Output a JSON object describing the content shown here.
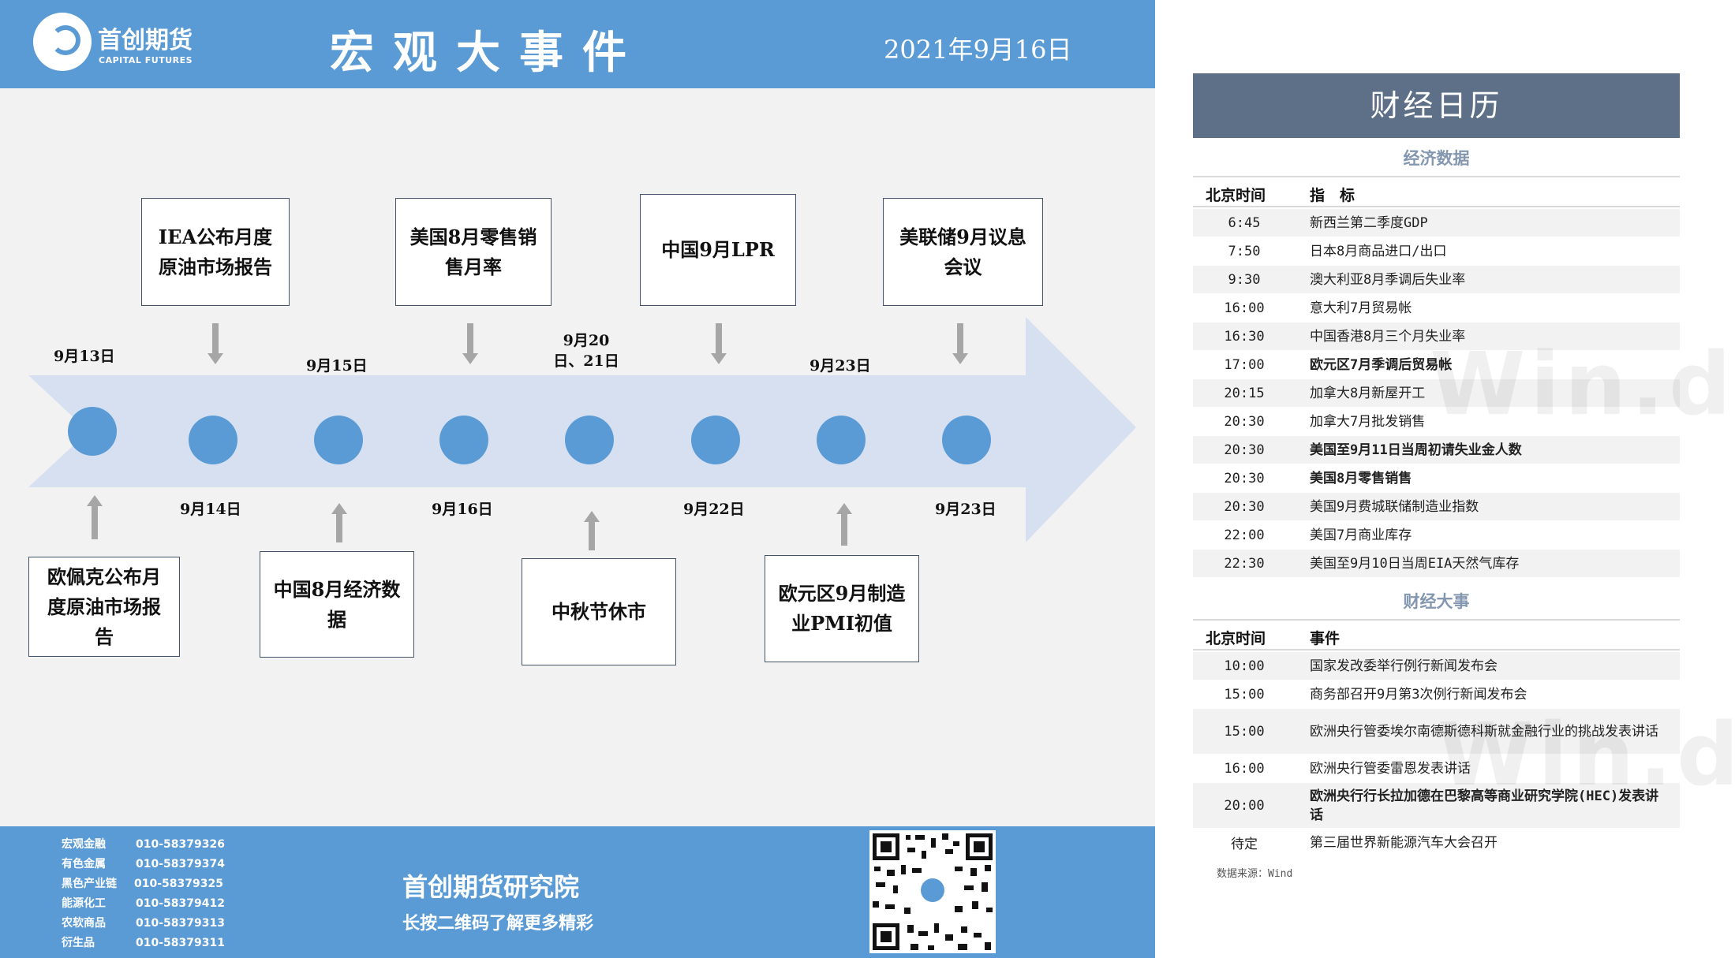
{
  "header": {
    "logo_cn": "首创期货",
    "logo_en": "CAPITAL FUTURES",
    "title": "宏观大事件",
    "date": "2021年9月16日"
  },
  "timeline": {
    "top_events": [
      {
        "text": "IEA公布月度原油市场报告"
      },
      {
        "text": "美国8月零售销售月率"
      },
      {
        "text": "中国9月LPR"
      },
      {
        "text": "美联储9月议息会议"
      }
    ],
    "top_dates": [
      "9月13日",
      "9月15日",
      "9月20日、21日",
      "9月23日"
    ],
    "bottom_dates": [
      "9月14日",
      "9月16日",
      "9月22日",
      "9月23日"
    ],
    "bottom_events": [
      {
        "text": "欧佩克公布月度原油市场报告"
      },
      {
        "text": "中国8月经济数据"
      },
      {
        "text": "中秋节休市"
      },
      {
        "text": "欧元区9月制造业PMI初值"
      }
    ],
    "colors": {
      "arrow": "#d6e0f0",
      "dot": "#5b9bd5",
      "connector": "#a6a6a6"
    }
  },
  "footer": {
    "contacts": [
      {
        "name": "宏观金融",
        "phone": "010-58379326"
      },
      {
        "name": "有色金属",
        "phone": "010-58379374"
      },
      {
        "name": "黑色产业链",
        "phone": "010-58379325"
      },
      {
        "name": "能源化工",
        "phone": "010-58379412"
      },
      {
        "name": "农软商品",
        "phone": "010-58379313"
      },
      {
        "name": "衍生品",
        "phone": "010-58379311"
      }
    ],
    "institute": "首创期货研究院",
    "slogan": "长按二维码了解更多精彩"
  },
  "calendar": {
    "title": "财经日历",
    "economic": {
      "section_title": "经济数据",
      "col_time": "北京时间",
      "col_indicator": "指　标",
      "rows": [
        {
          "time": "6:45",
          "text": "新西兰第二季度GDP",
          "bold": false
        },
        {
          "time": "7:50",
          "text": "日本8月商品进口/出口",
          "bold": false
        },
        {
          "time": "9:30",
          "text": "澳大利亚8月季调后失业率",
          "bold": false
        },
        {
          "time": "16:00",
          "text": "意大利7月贸易帐",
          "bold": false
        },
        {
          "time": "16:30",
          "text": "中国香港8月三个月失业率",
          "bold": false
        },
        {
          "time": "17:00",
          "text": "欧元区7月季调后贸易帐",
          "bold": true
        },
        {
          "time": "20:15",
          "text": "加拿大8月新屋开工",
          "bold": false
        },
        {
          "time": "20:30",
          "text": "加拿大7月批发销售",
          "bold": false
        },
        {
          "time": "20:30",
          "text": "美国至9月11日当周初请失业金人数",
          "bold": true
        },
        {
          "time": "20:30",
          "text": "美国8月零售销售",
          "bold": true
        },
        {
          "time": "20:30",
          "text": "美国9月费城联储制造业指数",
          "bold": false
        },
        {
          "time": "22:00",
          "text": "美国7月商业库存",
          "bold": false
        },
        {
          "time": "22:30",
          "text": "美国至9月10日当周EIA天然气库存",
          "bold": false
        }
      ]
    },
    "events": {
      "section_title": "财经大事",
      "col_time": "北京时间",
      "col_event": "事件",
      "rows": [
        {
          "time": "10:00",
          "text": "国家发改委举行例行新闻发布会",
          "bold": false
        },
        {
          "time": "15:00",
          "text": "商务部召开9月第3次例行新闻发布会",
          "bold": false
        },
        {
          "time": "15:00",
          "text": "欧洲央行管委埃尔南德斯德科斯就金融行业的挑战发表讲话",
          "bold": false
        },
        {
          "time": "16:00",
          "text": "欧洲央行管委雷恩发表讲话",
          "bold": false
        },
        {
          "time": "20:00",
          "text": "欧洲央行行长拉加德在巴黎高等商业研究学院(HEC)发表讲话",
          "bold": true
        },
        {
          "time": "待定",
          "text": "第三届世界新能源汽车大会召开",
          "bold": false
        }
      ]
    },
    "data_source": "数据来源：Wind",
    "watermark": "Win.d",
    "header_color": "#5e7088"
  }
}
